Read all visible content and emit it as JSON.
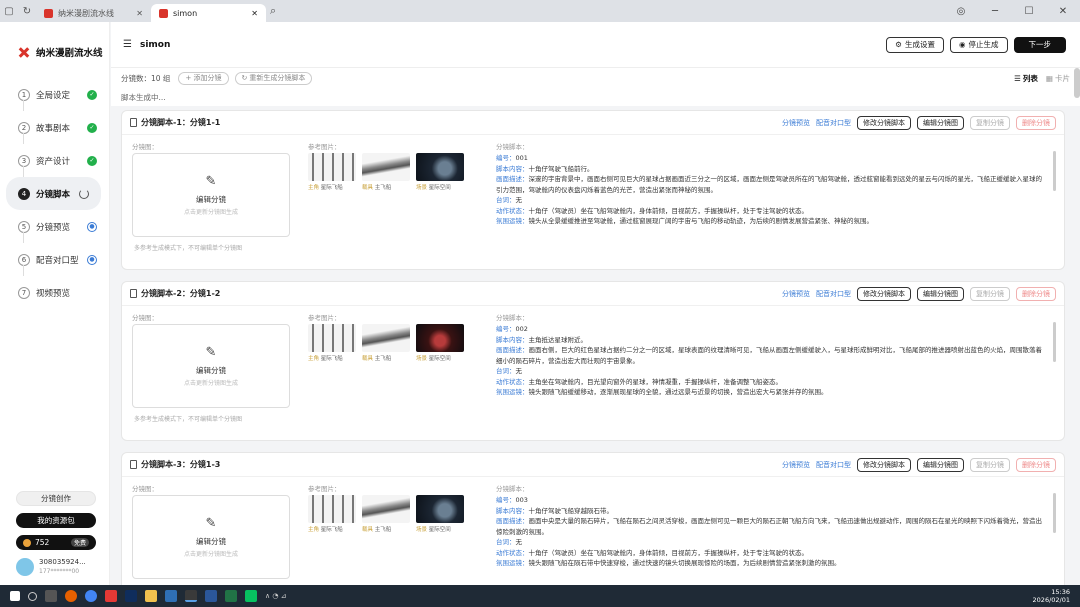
{
  "browser": {
    "tabs": [
      {
        "label": "纳米漫剧流水线",
        "active": false
      },
      {
        "label": "simon",
        "active": true
      }
    ]
  },
  "sidebar": {
    "logo_text": "纳米漫剧流水线",
    "steps": [
      {
        "num": "1",
        "label": "全局设定",
        "status": "done"
      },
      {
        "num": "2",
        "label": "故事剧本",
        "status": "done"
      },
      {
        "num": "3",
        "label": "资产设计",
        "status": "done"
      },
      {
        "num": "4",
        "label": "分镜脚本",
        "status": "in-progress"
      },
      {
        "num": "5",
        "label": "分镜预览",
        "status": "pending"
      },
      {
        "num": "6",
        "label": "配音对口型",
        "status": "pending"
      },
      {
        "num": "7",
        "label": "视频预览",
        "status": "none"
      }
    ],
    "bottom": {
      "community_label": "分镜创作",
      "upgrade_label": "我的资源包",
      "credits": "752",
      "vip_label": "免费",
      "user_name": "308035924...",
      "user_sub": "177*******00"
    }
  },
  "header": {
    "title": "simon",
    "settings_button": "生成设置",
    "stop_button": "停止生成",
    "next_button": "下一步"
  },
  "toolbar": {
    "count_label": "分镜数：10 组",
    "add_button": "+ 添加分镜",
    "regen_button": "重新生成分镜脚本",
    "view_list": "列表",
    "view_card": "卡片",
    "status_text": "脚本生成中..."
  },
  "card_labels": {
    "shot_label": "分镜图：",
    "ref_label": "参考图片：",
    "script_label": "分镜脚本：",
    "preview_link": "分镜预览",
    "dub_link": "配音对口型",
    "edit_script_button": "修改分镜脚本",
    "edit_shot_button": "编辑分镜图",
    "copy_button": "复制分镜",
    "delete_button": "删除分镜",
    "edit_box_title": "编辑分镜",
    "edit_box_sub": "点击更新分镜图生成",
    "hint": "多参考生成模式下，不可编辑单个分镜图"
  },
  "cards": [
    {
      "title": "分镜脚本-1：分镜1-1",
      "refs": [
        {
          "kind": "chars",
          "tag": "主角",
          "name": "星际飞船"
        },
        {
          "kind": "ship",
          "tag": "载具",
          "name": "主飞船"
        },
        {
          "kind": "space",
          "tag": "场景",
          "name": "星际空间"
        }
      ],
      "script": [
        {
          "k": "编号：",
          "v": "001"
        },
        {
          "k": "脚本内容：",
          "v": "十角仔驾驶飞船前行。"
        },
        {
          "k": "画面描述：",
          "v": "深邃的宇宙背景中，画面右侧可见巨大的星球占据画面近三分之一的区域，画面左侧是驾驶员所在的飞船驾驶舱，透过舷窗能看到远处的星云与闪烁的星光，飞船正缓缓驶入星球的引力范围，驾驶舱内的仪表盘闪烁着蓝色的光芒，营造出紧张而神秘的氛围。"
        },
        {
          "k": "台词：",
          "v": "无"
        },
        {
          "k": "动作状态：",
          "v": "十角仔（驾驶员）坐在飞船驾驶舱内，身体前倾，目视前方，手握操纵杆，处于专注驾驶的状态。"
        },
        {
          "k": "氛围运镜：",
          "v": "镜头从全景缓缓推进至驾驶舱，通过舷窗展现广阔的宇宙与飞船的移动轨迹，为后续的剧情发展营造紧张、神秘的氛围。"
        }
      ]
    },
    {
      "title": "分镜脚本-2：分镜1-2",
      "refs": [
        {
          "kind": "chars",
          "tag": "主角",
          "name": "星际飞船"
        },
        {
          "kind": "ship",
          "tag": "载具",
          "name": "主飞船"
        },
        {
          "kind": "space red",
          "tag": "场景",
          "name": "星际空间"
        }
      ],
      "script": [
        {
          "k": "编号：",
          "v": "002"
        },
        {
          "k": "脚本内容：",
          "v": "主角抵达星球附近。"
        },
        {
          "k": "画面描述：",
          "v": "画面右侧，巨大的红色星球占据约二分之一的区域，星球表面的纹理清晰可见，飞船从画面左侧缓缓驶入，与星球形成鲜明对比，飞船尾部的推进器喷射出蓝色的火焰，周围散落着细小的陨石碎片，营造出宏大而壮观的宇宙景象。"
        },
        {
          "k": "台词：",
          "v": "无"
        },
        {
          "k": "动作状态：",
          "v": "主角坐在驾驶舱内，目光望向窗外的星球，神情凝重，手握操纵杆，准备调整飞船姿态。"
        },
        {
          "k": "氛围运镜：",
          "v": "镜头跟随飞船缓缓移动，逐渐展现星球的全貌，通过远景与近景的切换，营造出宏大与紧张并存的氛围。"
        }
      ]
    },
    {
      "title": "分镜脚本-3：分镜1-3",
      "refs": [
        {
          "kind": "chars",
          "tag": "主角",
          "name": "星际飞船"
        },
        {
          "kind": "ship",
          "tag": "载具",
          "name": "主飞船"
        },
        {
          "kind": "space",
          "tag": "场景",
          "name": "星际空间"
        }
      ],
      "script": [
        {
          "k": "编号：",
          "v": "003"
        },
        {
          "k": "脚本内容：",
          "v": "十角仔驾驶飞船穿越陨石带。"
        },
        {
          "k": "画面描述：",
          "v": "画面中央是大量的陨石碎片，飞船在陨石之间灵活穿梭，画面左侧可见一颗巨大的陨石正朝飞船方向飞来，飞船迅速做出规避动作，周围的陨石在星光的映照下闪烁着微光，营造出惊险刺激的氛围。"
        },
        {
          "k": "台词：",
          "v": "无"
        },
        {
          "k": "动作状态：",
          "v": "十角仔（驾驶员）坐在飞船驾驶舱内，身体前倾，目视前方，手握操纵杆，处于专注驾驶的状态。"
        },
        {
          "k": "氛围运镜：",
          "v": "镜头跟随飞船在陨石带中快速穿梭，通过快速的镜头切换展现惊险的场面，为后续剧情营造紧张刺激的氛围。"
        }
      ]
    }
  ],
  "taskbar": {
    "time": "15:36",
    "date": "2026/02/01"
  }
}
